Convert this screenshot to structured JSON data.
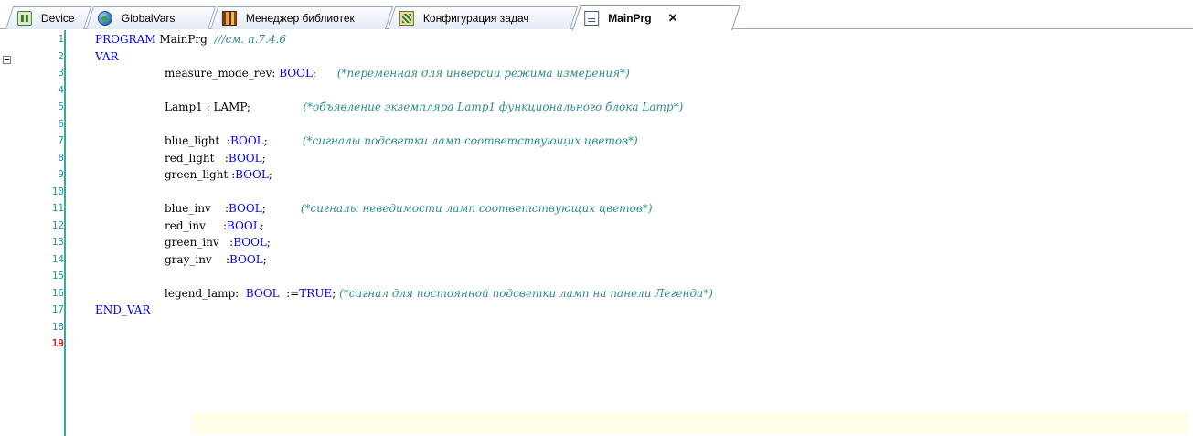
{
  "tabs": [
    {
      "label": "Device",
      "icon": "device-icon",
      "active": false
    },
    {
      "label": "GlobalVars",
      "icon": "globe-icon",
      "active": false
    },
    {
      "label": "Менеджер библиотек",
      "icon": "library-icon",
      "active": false
    },
    {
      "label": "Конфигурация задач",
      "icon": "task-config-icon",
      "active": false
    },
    {
      "label": "MainPrg",
      "icon": "program-page-icon",
      "active": true,
      "close": "✕"
    }
  ],
  "editor": {
    "current_line": 19,
    "colors": {
      "keyword": "#0000ff",
      "comment": "#2e8b8b",
      "line_number": "#2b91af",
      "current_line_number": "#c72a2a",
      "gutter_bar": "#3aa89c",
      "current_line_bg": "#fffde6"
    },
    "lines": [
      {
        "n": "1",
        "indent": 0,
        "parts": [
          {
            "t": "PROGRAM",
            "k": "kw"
          },
          {
            "t": " MainPrg  "
          },
          {
            "t": "///см. п.7.4.6",
            "k": "cm"
          }
        ]
      },
      {
        "n": "2",
        "indent": 0,
        "parts": [
          {
            "t": "VAR",
            "k": "kw"
          }
        ]
      },
      {
        "n": "3",
        "indent": 1,
        "parts": [
          {
            "t": "measure_mode_rev: "
          },
          {
            "t": "BOOL",
            "k": "kw"
          },
          {
            "t": ";      "
          },
          {
            "t": "(*переменная для инверсии режима измерения*)",
            "k": "cm"
          }
        ]
      },
      {
        "n": "4",
        "indent": 0,
        "parts": []
      },
      {
        "n": "5",
        "indent": 1,
        "parts": [
          {
            "t": "Lamp1 : LAMP;               "
          },
          {
            "t": "(*объявление экземпляра Lamp1 функционального блока Lamp*)",
            "k": "cm"
          }
        ]
      },
      {
        "n": "6",
        "indent": 0,
        "parts": []
      },
      {
        "n": "7",
        "indent": 1,
        "parts": [
          {
            "t": "blue_light  :"
          },
          {
            "t": "BOOL",
            "k": "kw"
          },
          {
            "t": ";          "
          },
          {
            "t": "(*сигналы подсветки ламп соответствующих цветов*)",
            "k": "cm"
          }
        ]
      },
      {
        "n": "8",
        "indent": 1,
        "parts": [
          {
            "t": "red_light   :"
          },
          {
            "t": "BOOL",
            "k": "kw"
          },
          {
            "t": ";"
          }
        ]
      },
      {
        "n": "9",
        "indent": 1,
        "parts": [
          {
            "t": "green_light :"
          },
          {
            "t": "BOOL",
            "k": "kw"
          },
          {
            "t": ";"
          }
        ]
      },
      {
        "n": "10",
        "indent": 0,
        "parts": []
      },
      {
        "n": "11",
        "indent": 1,
        "parts": [
          {
            "t": "blue_inv    :"
          },
          {
            "t": "BOOL",
            "k": "kw"
          },
          {
            "t": ";          "
          },
          {
            "t": "(*сигналы неведимости ламп соответствующих цветов*)",
            "k": "cm"
          }
        ]
      },
      {
        "n": "12",
        "indent": 1,
        "parts": [
          {
            "t": "red_inv     :"
          },
          {
            "t": "BOOL",
            "k": "kw"
          },
          {
            "t": ";"
          }
        ]
      },
      {
        "n": "13",
        "indent": 1,
        "parts": [
          {
            "t": "green_inv   :"
          },
          {
            "t": "BOOL",
            "k": "kw"
          },
          {
            "t": ";"
          }
        ]
      },
      {
        "n": "14",
        "indent": 1,
        "parts": [
          {
            "t": "gray_inv    :"
          },
          {
            "t": "BOOL",
            "k": "kw"
          },
          {
            "t": ";"
          }
        ]
      },
      {
        "n": "15",
        "indent": 0,
        "parts": []
      },
      {
        "n": "16",
        "indent": 1,
        "parts": [
          {
            "t": "legend_lamp:  "
          },
          {
            "t": "BOOL",
            "k": "kw"
          },
          {
            "t": "  :="
          },
          {
            "t": "TRUE",
            "k": "kw"
          },
          {
            "t": "; "
          },
          {
            "t": "(*сигнал для постоянной подсветки ламп на панели Легенда*)",
            "k": "cm"
          }
        ]
      },
      {
        "n": "17",
        "indent": 0,
        "parts": [
          {
            "t": "END_VAR",
            "k": "kw"
          }
        ]
      },
      {
        "n": "18",
        "indent": 0,
        "parts": []
      },
      {
        "n": "19",
        "indent": 0,
        "parts": []
      }
    ]
  }
}
